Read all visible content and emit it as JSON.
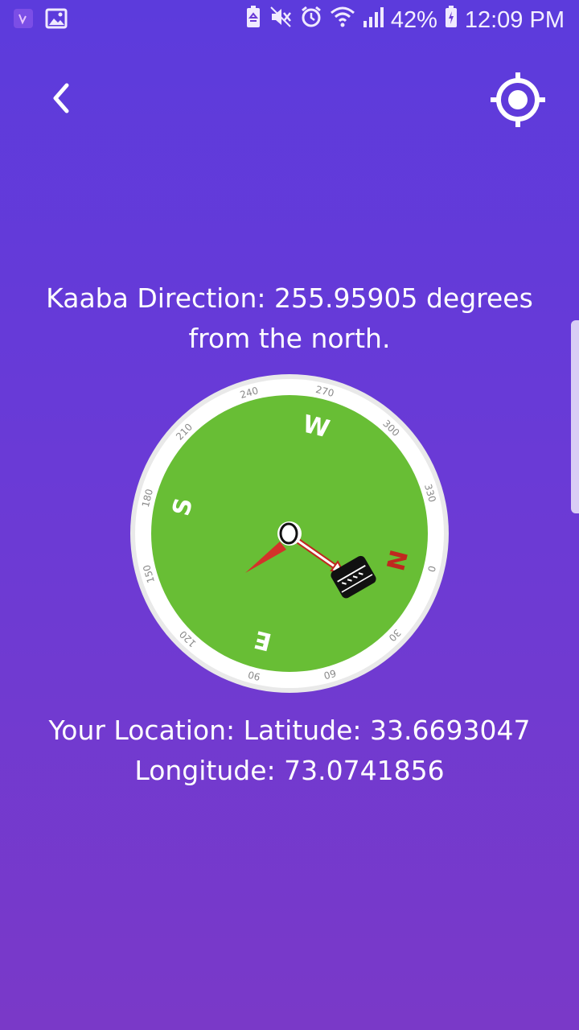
{
  "status_bar": {
    "battery_percent": "42%",
    "time": "12:09 PM",
    "icons": [
      "app-notification-icon",
      "image-icon",
      "battery-saver-icon",
      "mute-icon",
      "alarm-icon",
      "wifi-icon",
      "signal-icon",
      "battery-charging-icon"
    ]
  },
  "toolbar": {
    "back_icon": "chevron-left-icon",
    "locate_icon": "gps-locate-icon"
  },
  "kaaba": {
    "direction_line1": "Kaaba Direction: 255.95905 degrees",
    "direction_line2": "from the north."
  },
  "location": {
    "line1": "Your Location: Latitude: 33.6693047",
    "line2": "Longitude: 73.0741856"
  },
  "compass": {
    "cardinals": {
      "n": "N",
      "e": "E",
      "s": "S",
      "w": "W"
    },
    "ticks": [
      "0",
      "30",
      "60",
      "90",
      "120",
      "150",
      "180",
      "210",
      "240",
      "270",
      "300",
      "330"
    ],
    "colors": {
      "face": "#68be35",
      "ring": "#ffffff",
      "north": "#c0271f",
      "east_south_west": "#ffffff"
    }
  }
}
